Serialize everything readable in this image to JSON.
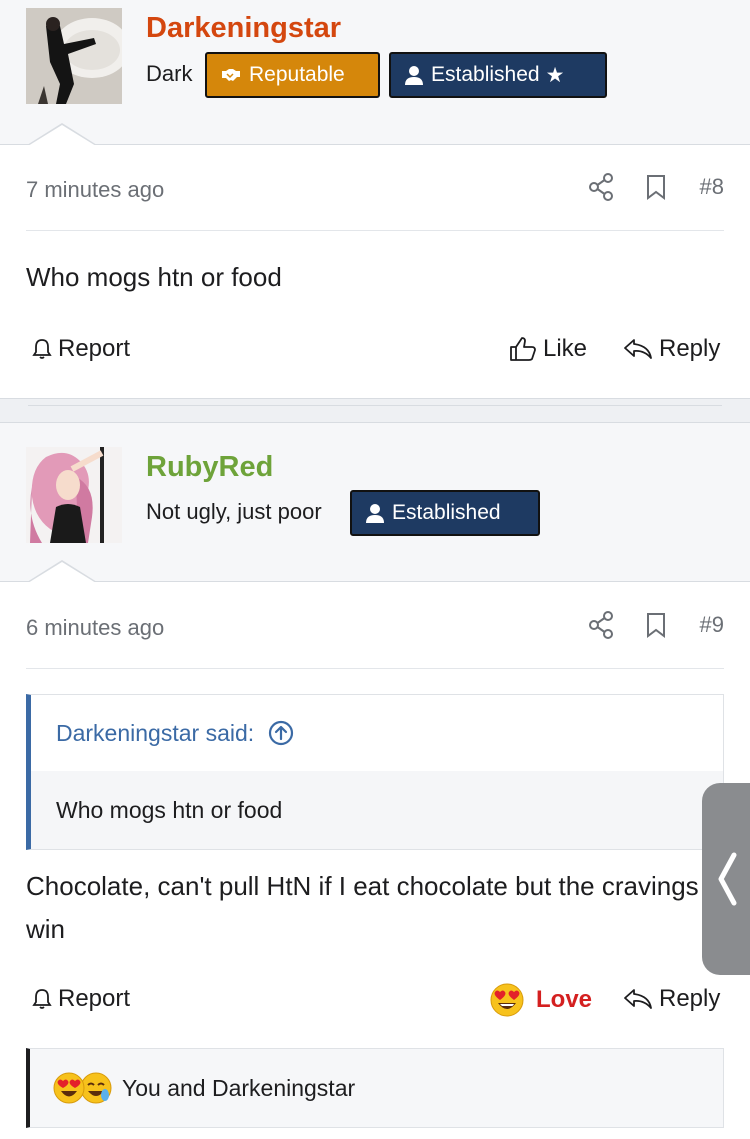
{
  "posts": [
    {
      "username": "Darkeningstar",
      "user_title": "Dark",
      "badges": [
        {
          "label": "Reputable",
          "icon": "handshake-icon"
        },
        {
          "label": "Established",
          "icon": "user-icon",
          "star": "★"
        }
      ],
      "time": "7 minutes ago",
      "number": "#8",
      "message": "Who mogs htn or food",
      "actions": {
        "report": "Report",
        "like": "Like",
        "reply": "Reply"
      }
    },
    {
      "username": "RubyRed",
      "user_title": "Not ugly, just poor",
      "badges": [
        {
          "label": "Established",
          "icon": "user-icon"
        }
      ],
      "time": "6 minutes ago",
      "number": "#9",
      "quote": {
        "author": "Darkeningstar said:",
        "text": "Who mogs htn or food"
      },
      "message": "Chocolate, can't pull HtN if I eat chocolate but the cravings win",
      "actions": {
        "report": "Report",
        "love": "Love",
        "reply": "Reply"
      },
      "reactions_text": "You and Darkeningstar"
    }
  ],
  "colors": {
    "username_post8": "#d4470f",
    "username_post9": "#6ea33a",
    "badge_reputable": "#d5870b",
    "badge_established": "#1e3a62",
    "quote_accent": "#3b6aa5",
    "love": "#d42020"
  },
  "side_tab": {
    "icon": "chevron-left-icon",
    "glyph": "❬"
  }
}
